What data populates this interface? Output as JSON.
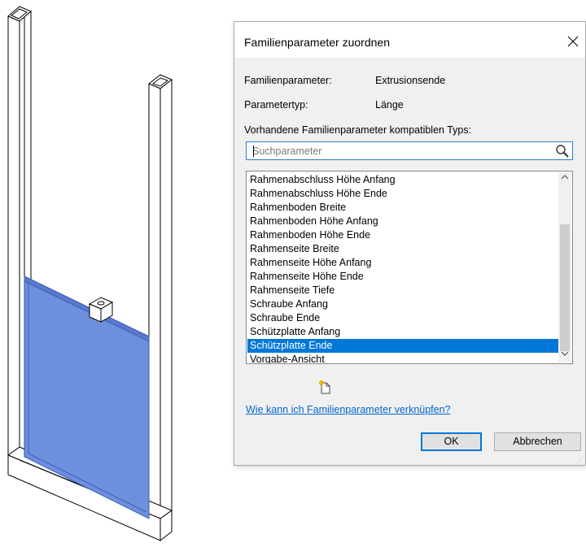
{
  "dialog": {
    "title": "Familienparameter zuordnen",
    "family_parameter_label": "Familienparameter:",
    "family_parameter_value": "Extrusionsende",
    "parameter_type_label": "Parametertyp:",
    "parameter_type_value": "Länge",
    "existing_label": "Vorhandene Familienparameter kompatiblen Typs:",
    "search_placeholder": "Suchparameter",
    "parameters": [
      "Rahmenabschluss Höhe Anfang",
      "Rahmenabschluss Höhe Ende",
      "Rahmenboden Breite",
      "Rahmenboden Höhe Anfang",
      "Rahmenboden Höhe Ende",
      "Rahmenseite Breite",
      "Rahmenseite Höhe Anfang",
      "Rahmenseite Höhe Ende",
      "Rahmenseite Tiefe",
      "Schraube Anfang",
      "Schraube Ende",
      "Schützplatte Anfang",
      "Schützplatte Ende",
      "Vorgabe-Ansicht"
    ],
    "selected_parameter": "Schützplatte Ende",
    "help_link": "Wie kann ich Familienparameter verknüpfen?",
    "ok_label": "OK",
    "cancel_label": "Abbrechen"
  },
  "icons": {
    "close": "close-icon",
    "search": "magnifier-icon",
    "new_parameter": "new-parameter-icon"
  },
  "colors": {
    "selection": "#0078d7",
    "link": "#0066cc",
    "panel_fill": "#6e8fdc",
    "panel_edge": "#3d5db8"
  }
}
